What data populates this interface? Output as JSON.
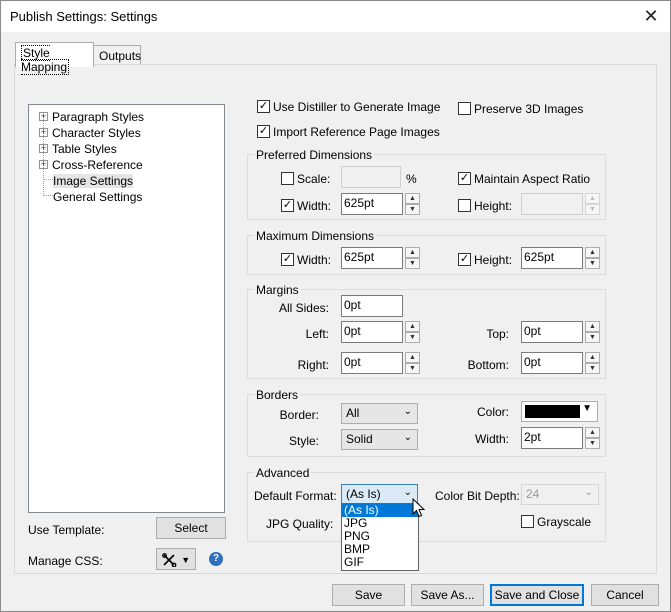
{
  "window": {
    "title": "Publish Settings: Settings",
    "close_icon": "close-icon"
  },
  "tabs": [
    {
      "label": "Style Mapping",
      "active": true
    },
    {
      "label": "Outputs",
      "active": false
    }
  ],
  "tree": {
    "items": [
      {
        "label": "Paragraph Styles",
        "expandable": true
      },
      {
        "label": "Character Styles",
        "expandable": true
      },
      {
        "label": "Table Styles",
        "expandable": true
      },
      {
        "label": "Cross-Reference",
        "expandable": true
      },
      {
        "label": "Image Settings",
        "expandable": false,
        "selected": true
      },
      {
        "label": "General Settings",
        "expandable": false
      }
    ]
  },
  "options": {
    "use_distiller": {
      "label": "Use Distiller to Generate Image",
      "checked": true
    },
    "preserve_3d": {
      "label": "Preserve 3D Images",
      "checked": false
    },
    "import_ref_page": {
      "label": "Import Reference Page Images",
      "checked": true
    }
  },
  "preferred": {
    "title": "Preferred Dimensions",
    "scale": {
      "label": "Scale:",
      "checked": false,
      "value": "",
      "unit": "%"
    },
    "maintain_aspect": {
      "label": "Maintain Aspect Ratio",
      "checked": true
    },
    "width": {
      "label": "Width:",
      "checked": true,
      "value": "625pt"
    },
    "height": {
      "label": "Height:",
      "checked": false,
      "value": ""
    }
  },
  "maximum": {
    "title": "Maximum Dimensions",
    "width": {
      "label": "Width:",
      "checked": true,
      "value": "625pt"
    },
    "height": {
      "label": "Height:",
      "checked": true,
      "value": "625pt"
    }
  },
  "margins": {
    "title": "Margins",
    "all_sides": {
      "label": "All Sides:",
      "value": "0pt"
    },
    "left": {
      "label": "Left:",
      "value": "0pt"
    },
    "top": {
      "label": "Top:",
      "value": "0pt"
    },
    "right": {
      "label": "Right:",
      "value": "0pt"
    },
    "bottom": {
      "label": "Bottom:",
      "value": "0pt"
    }
  },
  "borders": {
    "title": "Borders",
    "border": {
      "label": "Border:",
      "value": "All"
    },
    "color": {
      "label": "Color:",
      "value": "#000000"
    },
    "style": {
      "label": "Style:",
      "value": "Solid"
    },
    "width": {
      "label": "Width:",
      "value": "2pt"
    }
  },
  "advanced": {
    "title": "Advanced",
    "default_format": {
      "label": "Default Format:",
      "value": "(As Is)",
      "options": [
        "(As Is)",
        "JPG",
        "PNG",
        "BMP",
        "GIF"
      ],
      "highlighted": 0
    },
    "color_bit_depth": {
      "label": "Color Bit Depth:",
      "value": "24"
    },
    "jpg_quality": {
      "label": "JPG Quality:"
    },
    "grayscale": {
      "label": "Grayscale",
      "checked": false
    }
  },
  "template": {
    "label": "Use Template:",
    "button": "Select"
  },
  "css": {
    "label": "Manage CSS:",
    "help": "?"
  },
  "footer": {
    "save": "Save",
    "save_as": "Save As...",
    "save_close": "Save and Close",
    "cancel": "Cancel"
  },
  "colors": {
    "accent": "#0078d7",
    "dialog_bg": "#f0f0f0"
  }
}
